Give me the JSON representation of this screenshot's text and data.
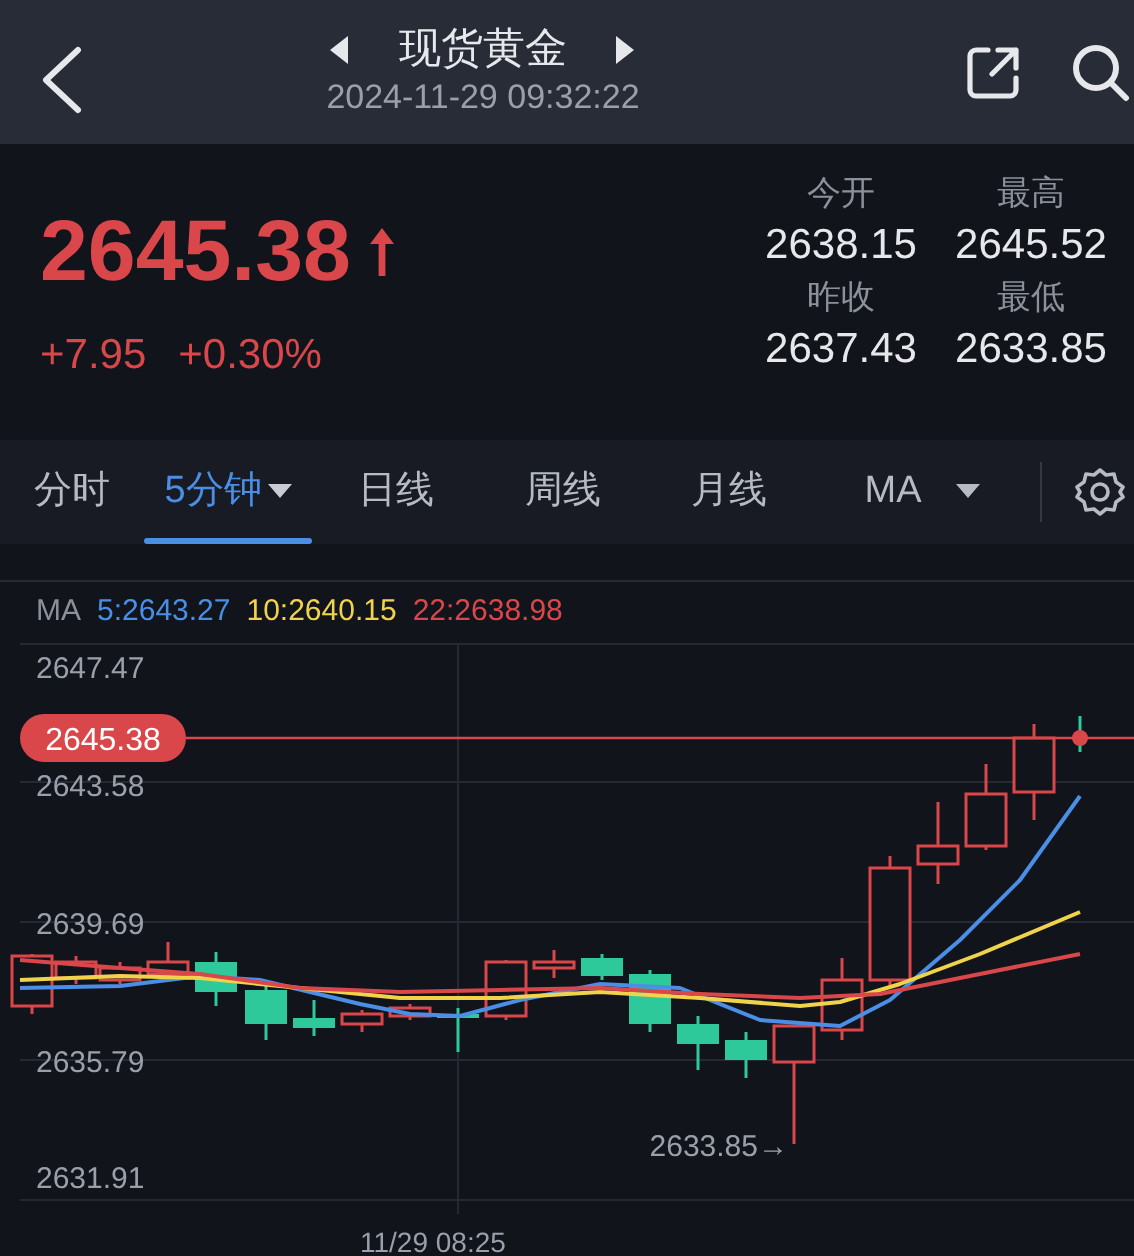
{
  "header": {
    "title": "现货黄金",
    "datetime": "2024-11-29 09:32:22"
  },
  "quote": {
    "price": "2645.38",
    "rising": true,
    "change": "+7.95",
    "change_pct": "+0.30%",
    "stats": [
      {
        "label": "今开",
        "value": "2638.15"
      },
      {
        "label": "最高",
        "value": "2645.52"
      },
      {
        "label": "昨收",
        "value": "2637.43"
      },
      {
        "label": "最低",
        "value": "2633.85"
      }
    ]
  },
  "tabs": [
    {
      "label": "分时",
      "selected": false,
      "dropdown": false
    },
    {
      "label": "5分钟",
      "selected": true,
      "dropdown": true
    },
    {
      "label": "日线",
      "selected": false,
      "dropdown": false
    },
    {
      "label": "周线",
      "selected": false,
      "dropdown": false
    },
    {
      "label": "月线",
      "selected": false,
      "dropdown": false
    },
    {
      "label": "MA",
      "selected": false,
      "dropdown": true
    }
  ],
  "ma_legend": {
    "label": "MA",
    "items": [
      {
        "text": "5:2643.27",
        "color": "#4a8ee6"
      },
      {
        "text": "10:2640.15",
        "color": "#f0d34a"
      },
      {
        "text": "22:2638.98",
        "color": "#d9474b"
      }
    ]
  },
  "chart": {
    "y_labels": [
      "2647.47",
      "2643.58",
      "2639.69",
      "2635.79",
      "2631.91"
    ],
    "price_tag": "2645.38",
    "low_marker": "2633.85→",
    "time_label": "11/29 08:25"
  }
}
